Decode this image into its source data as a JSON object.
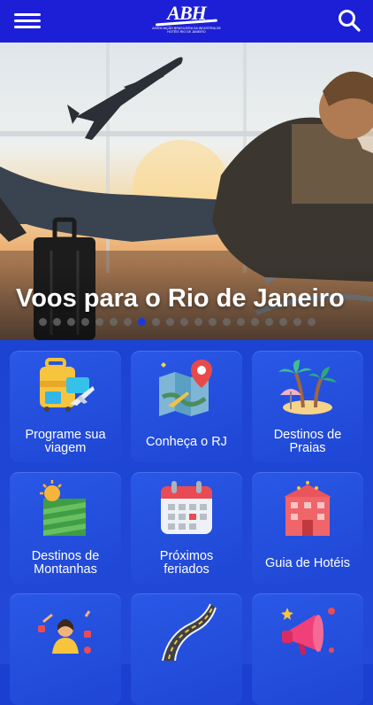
{
  "header": {
    "logo_text": "ABH",
    "logo_subtitle": "ASSOCIAÇÃO BRASILEIRA DA INDÚSTRIA DE HOTÉIS RIO DE JANEIRO",
    "menu_icon": "hamburger-menu-icon",
    "search_icon": "search-icon"
  },
  "hero": {
    "title": "Voos para o Rio de Janeiro",
    "slide_count": 20,
    "active_slide": 7
  },
  "tiles": [
    {
      "label": "Programe sua\nviagem",
      "icon": "suitcase-plane-icon"
    },
    {
      "label": "Conheça o RJ",
      "icon": "map-pin-icon"
    },
    {
      "label": "Destinos de\nPraias",
      "icon": "palm-island-icon"
    },
    {
      "label": "Destinos de\nMontanhas",
      "icon": "mountain-field-icon"
    },
    {
      "label": "Próximos\nferiados",
      "icon": "calendar-icon"
    },
    {
      "label": "Guia de Hotéis",
      "icon": "hotel-building-icon"
    },
    {
      "label": "",
      "icon": "person-social-icon"
    },
    {
      "label": "",
      "icon": "road-icon"
    },
    {
      "label": "",
      "icon": "megaphone-icon"
    }
  ],
  "colors": {
    "header": "#1d1fd6",
    "grid_bg": "#1c43d2",
    "dot_active": "#1a3ad8"
  }
}
